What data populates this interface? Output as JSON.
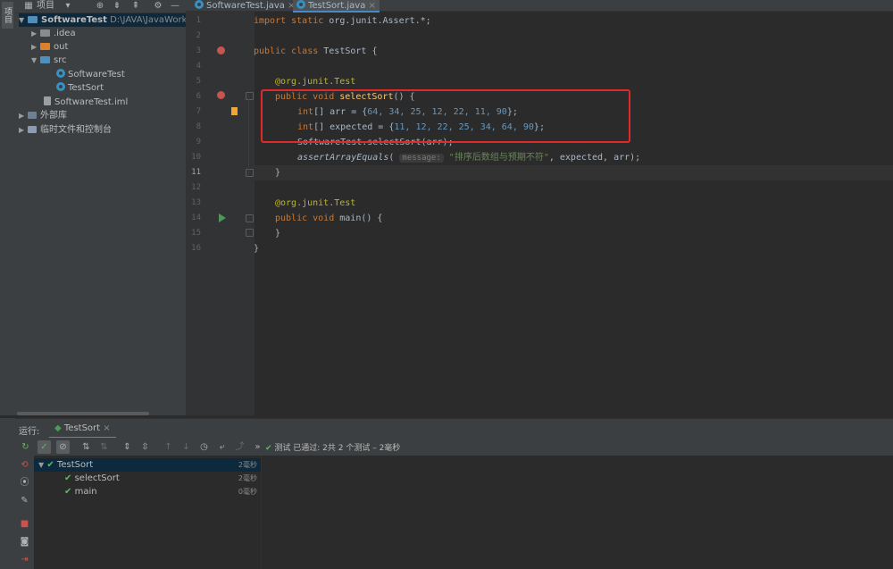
{
  "left_strip": {
    "tab_label": "项目"
  },
  "project_panel": {
    "title": "项目",
    "tree": [
      {
        "label": "SoftwareTest",
        "detail": "D:\\JAVA\\JavaWork\\Sc",
        "indent": 0,
        "expanded": true,
        "icon": "module-folder-icon"
      },
      {
        "label": ".idea",
        "indent": 1,
        "expanded": false,
        "icon": "folder-icon"
      },
      {
        "label": "out",
        "indent": 1,
        "expanded": false,
        "icon": "folder-orange-icon"
      },
      {
        "label": "src",
        "indent": 1,
        "expanded": true,
        "icon": "source-folder-icon"
      },
      {
        "label": "SoftwareTest",
        "indent": 2,
        "icon": "java-class-icon"
      },
      {
        "label": "TestSort",
        "indent": 2,
        "icon": "java-class-icon"
      },
      {
        "label": "SoftwareTest.iml",
        "indent": 1,
        "icon": "iml-file-icon"
      },
      {
        "label": "外部库",
        "indent": 0,
        "expanded": false,
        "icon": "library-icon"
      },
      {
        "label": "临时文件和控制台",
        "indent": 0,
        "expanded": false,
        "icon": "scratch-icon"
      }
    ]
  },
  "editor": {
    "tabs": [
      {
        "label": "SoftwareTest.java",
        "close": "×",
        "active": false
      },
      {
        "label": "TestSort.java",
        "close": "×",
        "active": true
      }
    ],
    "line_numbers": [
      "1",
      "2",
      "3",
      "4",
      "5",
      "6",
      "7",
      "8",
      "9",
      "10",
      "11",
      "12",
      "13",
      "14",
      "15",
      "16"
    ],
    "current_line": "11",
    "code": {
      "l1_kw": "import static",
      "l1_rest": " org.junit.Assert.*;",
      "l3_kw": "public class",
      "l3_rest": " TestSort {",
      "l5_ann": "@org.junit.Test",
      "l6_kw": "public void",
      "l6_fn": "selectSort",
      "l6_rest": "() {",
      "l7_kw": "int",
      "l7_a": "[] arr = {",
      "l7_nums": "64, 34, 25, 12, 22, 11, 90",
      "l7_end": "};",
      "l8_kw": "int",
      "l8_a": "[] expected = {",
      "l8_nums": "11, 12, 22, 25, 34, 64, 90",
      "l8_end": "};",
      "l9": "SoftwareTest.selectSort(arr);",
      "l10_fn": "assertArrayEquals",
      "l10_hint": "message:",
      "l10_str": "\"排序后数组与预期不符\"",
      "l10_rest": ", expected, arr);",
      "l11": "}",
      "l13_ann": "@org.junit.Test",
      "l14_kw": "public void",
      "l14_fn": "main",
      "l14_rest": "() {",
      "l15": "}",
      "l16": "}"
    }
  },
  "run_panel": {
    "label": "运行:",
    "tab_label": "TestSort",
    "tab_close": "×",
    "status_text": "测试 已通过: 2共 2 个测试 – 2毫秒",
    "results": [
      {
        "label": "TestSort",
        "time": "2毫秒",
        "indent": 0
      },
      {
        "label": "selectSort",
        "time": "2毫秒",
        "indent": 1
      },
      {
        "label": "main",
        "time": "0毫秒",
        "indent": 1
      }
    ]
  },
  "colors": {
    "accent": "#4a88c7",
    "pass": "#5fb760",
    "highlight_box": "#e0292b"
  }
}
